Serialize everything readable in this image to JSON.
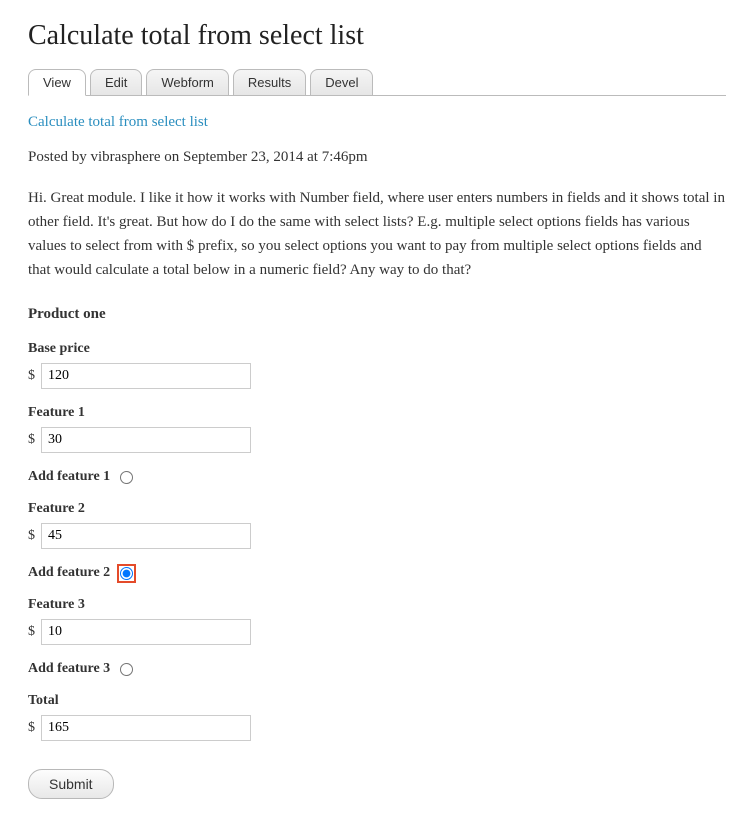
{
  "page_title": "Calculate total from select list",
  "tabs": [
    {
      "label": "View",
      "active": true
    },
    {
      "label": "Edit",
      "active": false
    },
    {
      "label": "Webform",
      "active": false
    },
    {
      "label": "Results",
      "active": false
    },
    {
      "label": "Devel",
      "active": false
    }
  ],
  "link_title": "Calculate total from select list",
  "meta": "Posted by vibrasphere on September 23, 2014 at 7:46pm",
  "body": "Hi. Great module. I like it how it works with Number field, where user enters numbers in fields and it shows total in other field. It's great. But how do I do the same with select lists? E.g. multiple select options fields has various values to select from with $ prefix, so you select options you want to pay from multiple select options fields and that would calculate a total below in a numeric field? Any way to do that?",
  "section_heading": "Product one",
  "currency_prefix": "$",
  "fields": {
    "base_price": {
      "label": "Base price",
      "value": "120"
    },
    "feature1": {
      "label": "Feature 1",
      "value": "30"
    },
    "add_feature1": {
      "label": "Add feature 1",
      "checked": false
    },
    "feature2": {
      "label": "Feature 2",
      "value": "45"
    },
    "add_feature2": {
      "label": "Add feature 2",
      "checked": true
    },
    "feature3": {
      "label": "Feature 3",
      "value": "10"
    },
    "add_feature3": {
      "label": "Add feature 3",
      "checked": false
    },
    "total": {
      "label": "Total",
      "value": "165"
    }
  },
  "submit_label": "Submit"
}
